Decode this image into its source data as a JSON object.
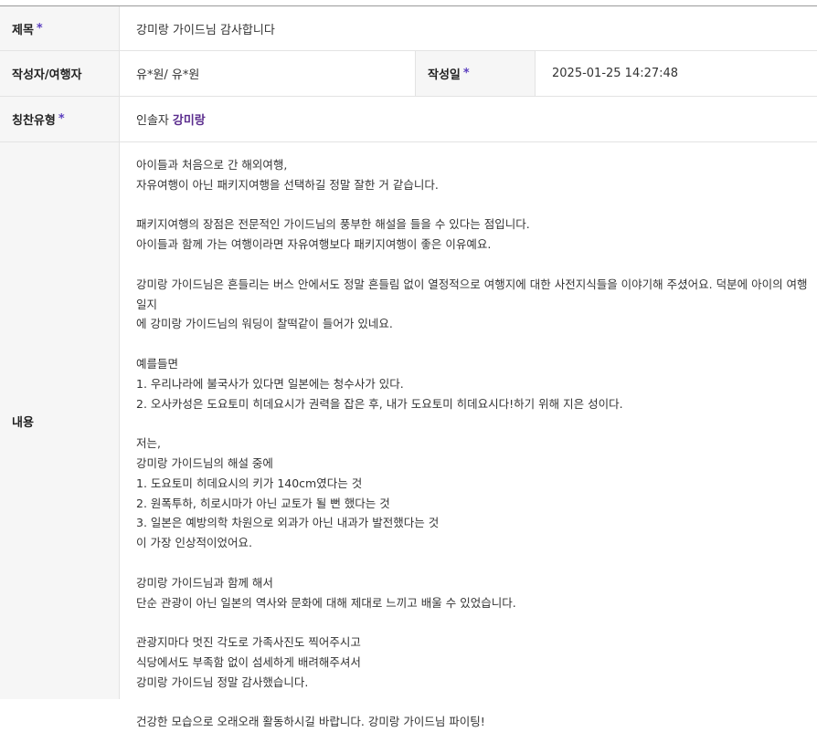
{
  "fields": {
    "title_label": "제목",
    "title_value": "강미랑 가이드님 감사합니다",
    "author_label": "작성자/여행자",
    "author_value": "유*원/ 유*원",
    "date_label": "작성일",
    "date_value": "2025-01-25 14:27:48",
    "praise_label": "칭찬유형",
    "praise_prefix": "인솔자",
    "praise_guide": "강미랑",
    "content_label": "내용",
    "required_mark": "*"
  },
  "content_lines": [
    "아이들과 처음으로 간 해외여행,",
    "자유여행이 아닌 패키지여행을 선택하길 정말 잘한 거 같습니다.",
    "",
    "패키지여행의 장점은 전문적인 가이드님의 풍부한 해설을 들을 수 있다는 점입니다.",
    "아이들과 함께 가는 여행이라면 자유여행보다 패키지여행이 좋은 이유예요.",
    "",
    "강미랑 가이드님은 흔들리는 버스 안에서도 정말 흔들림 없이 열정적으로 여행지에 대한 사전지식들을 이야기해 주셨어요. 덕분에 아이의 여행일지",
    "에 강미랑 가이드님의 워딩이 찰떡같이 들어가 있네요.",
    "",
    "예를들면",
    "1. 우리나라에 불국사가 있다면 일본에는 청수사가 있다.",
    "2. 오사카성은 도요토미 히데요시가 권력을 잡은 후, 내가 도요토미 히데요시다!하기 위해 지은 성이다.",
    "",
    "저는,",
    "강미랑 가이드님의 해설 중에",
    "1. 도요토미 히데요시의 키가 140cm였다는 것",
    "2. 원폭투하, 히로시마가 아닌 교토가 될 뻔 했다는 것",
    "3. 일본은 예방의학 차원으로 외과가 아닌 내과가 발전했다는 것",
    "이 가장 인상적이었어요.",
    "",
    "강미랑 가이드님과 함께 해서",
    "단순 관광이 아닌 일본의 역사와 문화에 대해 제대로 느끼고 배울 수 있었습니다.",
    "",
    "관광지마다 멋진 각도로 가족사진도 찍어주시고",
    "식당에서도 부족함 없이 섬세하게 배려해주셔서",
    "강미랑 가이드님 정말 감사했습니다.",
    "",
    "건강한 모습으로 오래오래 활동하시길 바랍니다. 강미랑 가이드님 파이팅!"
  ]
}
